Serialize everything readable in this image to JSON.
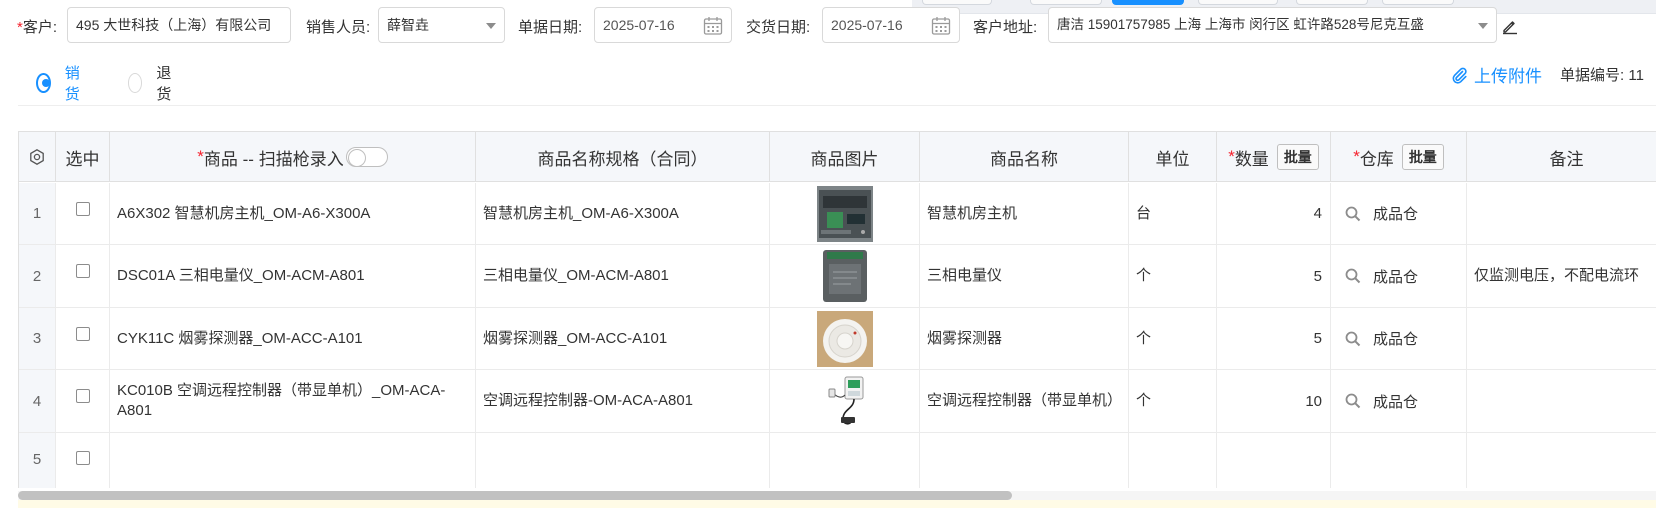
{
  "form": {
    "customer_label": "客户:",
    "customer_value": "495 大世科技（上海）有限公司",
    "sales_label": "销售人员:",
    "sales_value": "薛智垚",
    "bill_date_label": "单据日期:",
    "bill_date_value": "2025-07-16",
    "delivery_date_label": "交货日期:",
    "delivery_date_value": "2025-07-16",
    "address_label": "客户地址:",
    "address_value": "唐洁 15901757985 上海 上海市 闵行区 虹许路528号尼克互盛"
  },
  "type_radio": {
    "sale_label": "销货",
    "return_label": "退货",
    "selected": "销货"
  },
  "upload_label": "上传附件",
  "bill_no_label": "单据编号: 11",
  "table": {
    "headers": {
      "select": "选中",
      "product": "商品 -- 扫描枪录入",
      "spec": "商品名称规格（合同）",
      "image": "商品图片",
      "name": "商品名称",
      "unit": "单位",
      "qty": "数量",
      "warehouse": "仓库",
      "remark": "备注",
      "bulk": "批量"
    },
    "rows": [
      {
        "no": "1",
        "product": "A6X302 智慧机房主机_OM-A6-X300A",
        "spec": "智慧机房主机_OM-A6-X300A",
        "name": "智慧机房主机",
        "unit": "台",
        "qty": "4",
        "warehouse": "成品仓",
        "remark": "",
        "image": "server-unit-photo"
      },
      {
        "no": "2",
        "product": "DSC01A 三相电量仪_OM-ACM-A801",
        "spec": "三相电量仪_OM-ACM-A801",
        "name": "三相电量仪",
        "unit": "个",
        "qty": "5",
        "warehouse": "成品仓",
        "remark": "仅监测电压，不配电流环",
        "image": "power-meter-photo"
      },
      {
        "no": "3",
        "product": "CYK11C 烟雾探测器_OM-ACC-A101",
        "spec": "烟雾探测器_OM-ACC-A101",
        "name": "烟雾探测器",
        "unit": "个",
        "qty": "5",
        "warehouse": "成品仓",
        "remark": "",
        "image": "smoke-detector-photo"
      },
      {
        "no": "4",
        "product": "KC010B 空调远程控制器（带显单机）_OM-ACA-A801",
        "spec": "空调远程控制器-OM-ACA-A801",
        "name": "空调远程控制器（带显单机）",
        "unit": "个",
        "qty": "10",
        "warehouse": "成品仓",
        "remark": "",
        "image": "ac-controller-photo"
      },
      {
        "no": "5",
        "product": "",
        "spec": "",
        "name": "",
        "unit": "",
        "qty": "",
        "warehouse": "",
        "remark": "",
        "image": ""
      }
    ]
  },
  "colors": {
    "accent": "#1890ff",
    "required": "#f5222d",
    "header_bg": "#f5f7fa"
  }
}
